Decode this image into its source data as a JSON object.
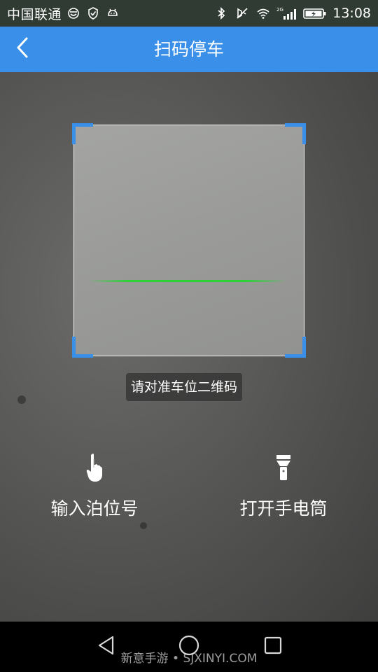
{
  "status_bar": {
    "carrier": "中国联通",
    "time": "13:08",
    "network": "2G",
    "icons": [
      "smiley-notification-icon",
      "shield-notification-icon",
      "android-icon",
      "bluetooth-icon",
      "vibrate-off-icon",
      "wifi-icon",
      "signal-icon",
      "battery-icon"
    ]
  },
  "header": {
    "title": "扫码停车",
    "back_icon": "chevron-left-icon",
    "background": "#3a90e8"
  },
  "scanner": {
    "hint": "请对准车位二维码",
    "frame_corner_color": "#3a90e8",
    "scan_line_color": "#2fcf3a"
  },
  "actions": {
    "input_spot": {
      "label": "输入泊位号",
      "icon": "hand-pointer-icon"
    },
    "flashlight": {
      "label": "打开手电筒",
      "icon": "flashlight-icon"
    }
  },
  "nav_bar": {
    "buttons": [
      "back-triangle-icon",
      "home-circle-icon",
      "recents-square-icon"
    ],
    "watermark": "新意手游 • SJXINYI.COM"
  }
}
